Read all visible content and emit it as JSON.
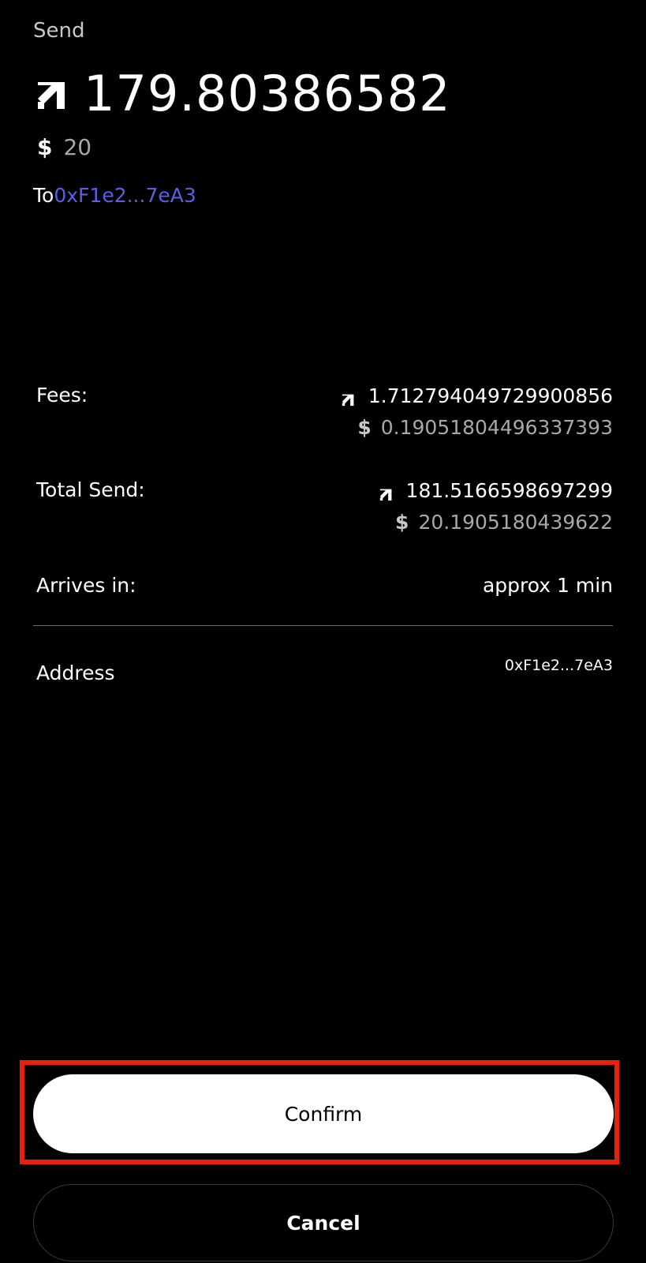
{
  "header": {
    "title": "Send"
  },
  "amount": {
    "token_icon": "token-arrow-icon",
    "value": "179.80386582",
    "fiat_symbol": "$",
    "fiat_value": "20"
  },
  "recipient": {
    "label": "To",
    "address": "0xF1e2...7eA3"
  },
  "details": {
    "fees": {
      "label": "Fees:",
      "token_icon": "token-arrow-icon",
      "token_value": "1.712794049729900856",
      "fiat_symbol": "$",
      "fiat_value": "0.19051804496337393"
    },
    "total_send": {
      "label": "Total Send:",
      "token_icon": "token-arrow-icon",
      "token_value": "181.5166598697299",
      "fiat_symbol": "$",
      "fiat_value": "20.1905180439622"
    },
    "arrives_in": {
      "label": "Arrives in:",
      "value": "approx 1 min"
    },
    "address": {
      "label": "Address",
      "value": "0xF1e2...7eA3"
    }
  },
  "actions": {
    "confirm_label": "Confirm",
    "cancel_label": "Cancel"
  },
  "colors": {
    "background": "#000000",
    "link": "#5b5fe4",
    "muted_text": "#a8a8a8",
    "highlight": "#e8210f",
    "primary_button": "#ffffff"
  }
}
